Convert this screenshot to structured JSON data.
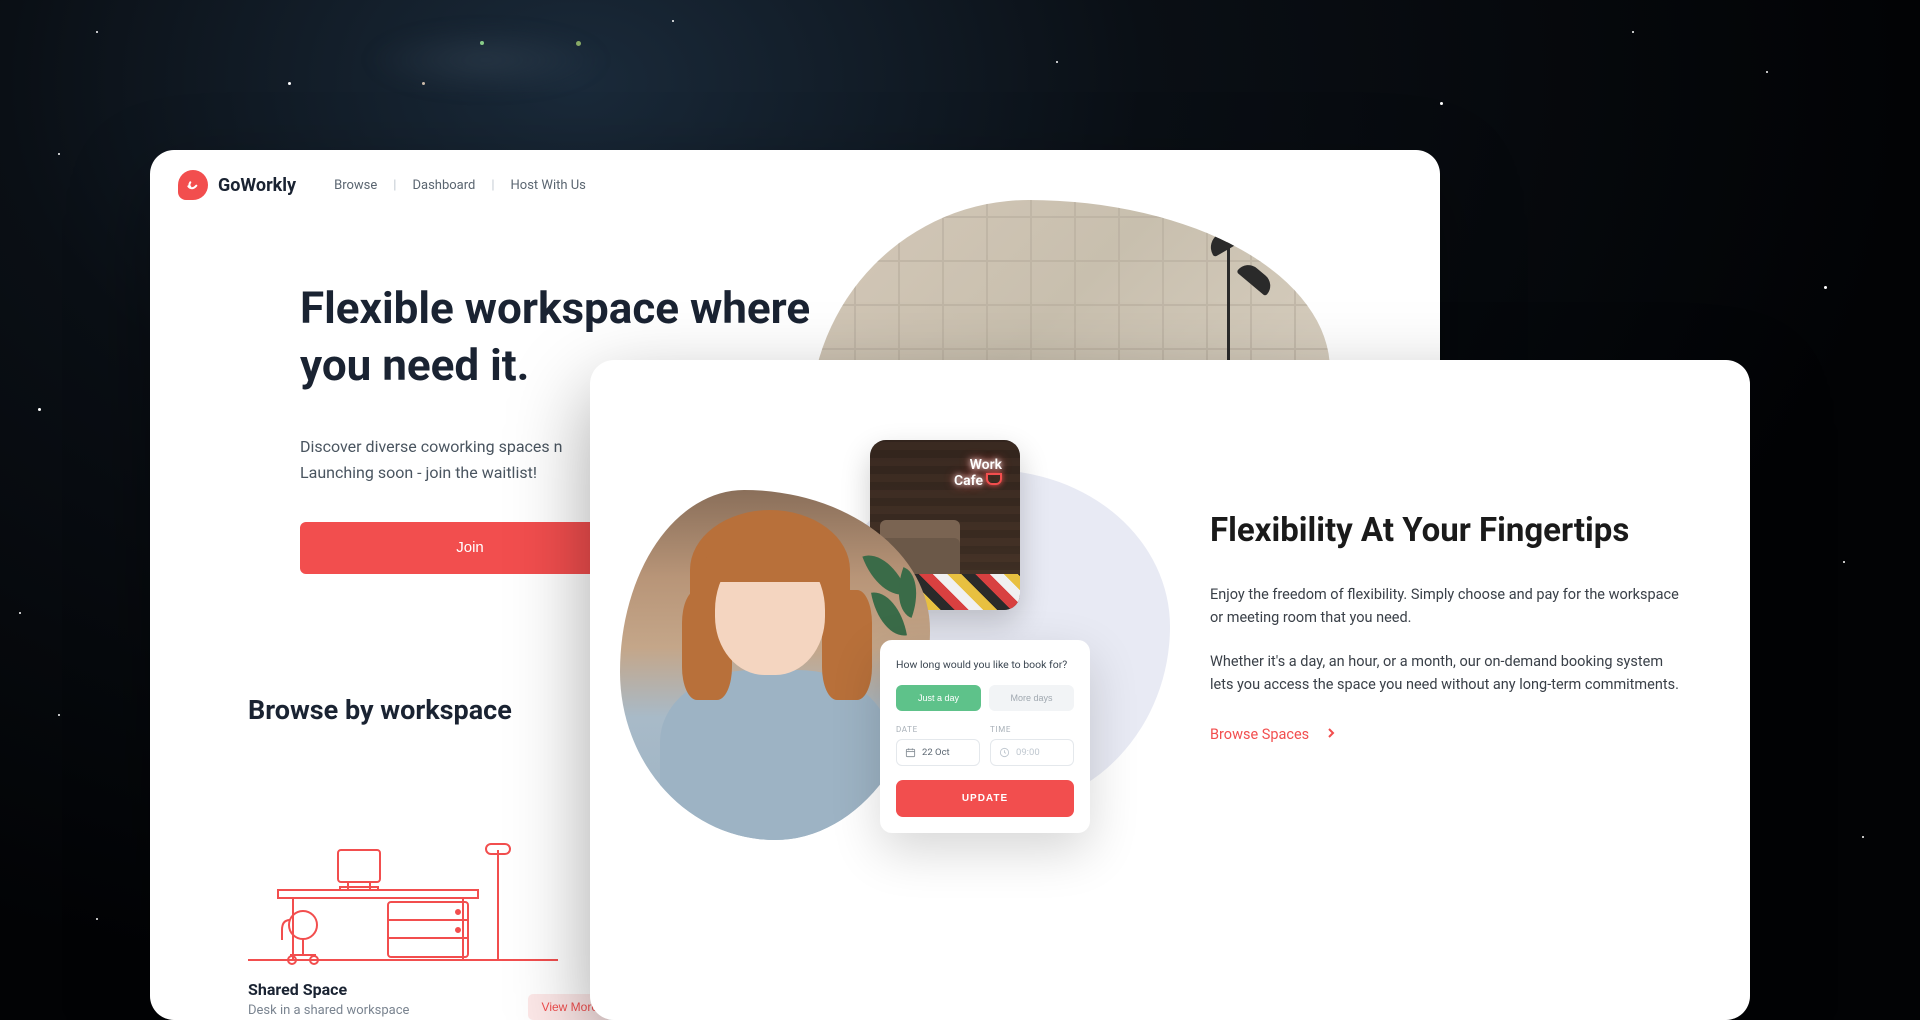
{
  "brand": {
    "name": "GoWorkly"
  },
  "nav": {
    "browse": "Browse",
    "dashboard": "Dashboard",
    "host": "Host With Us"
  },
  "hero": {
    "title": "Flexible workspace where you need it.",
    "sub1": "Discover diverse coworking spaces n",
    "sub2": "Launching soon - join the waitlist!",
    "cta": "Join"
  },
  "browse": {
    "heading": "Browse by workspace",
    "card": {
      "title": "Shared Space",
      "sub": "Desk in a shared workspace",
      "view_more": "View More"
    }
  },
  "cafe": {
    "line1": "Work",
    "line2": "Cafe"
  },
  "booking": {
    "question": "How long would you like to book for?",
    "seg_day": "Just a day",
    "seg_more": "More days",
    "date_label": "DATE",
    "time_label": "TIME",
    "date_value": "22 Oct",
    "time_value": "09:00",
    "update": "UPDATE"
  },
  "flex": {
    "title": "Flexibility At Your Fingertips",
    "p1": "Enjoy the freedom of flexibility. Simply choose and pay for the workspace or meeting room that you need.",
    "p2": "Whether it's a day, an hour, or a month, our on-demand booking system lets you access the space you need without any long-term commitments.",
    "link": "Browse Spaces"
  }
}
